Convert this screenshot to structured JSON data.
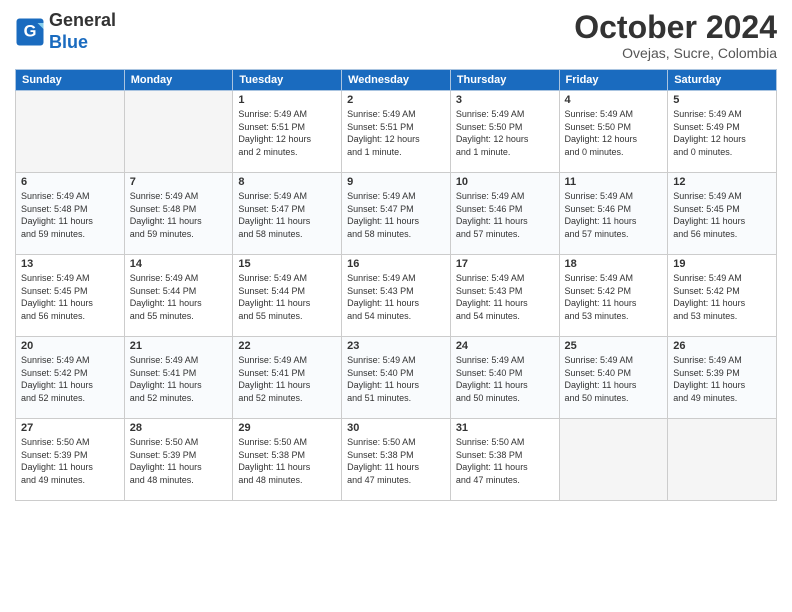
{
  "header": {
    "logo_general": "General",
    "logo_blue": "Blue",
    "month_title": "October 2024",
    "location": "Ovejas, Sucre, Colombia"
  },
  "weekdays": [
    "Sunday",
    "Monday",
    "Tuesday",
    "Wednesday",
    "Thursday",
    "Friday",
    "Saturday"
  ],
  "weeks": [
    [
      {
        "day": "",
        "info": ""
      },
      {
        "day": "",
        "info": ""
      },
      {
        "day": "1",
        "info": "Sunrise: 5:49 AM\nSunset: 5:51 PM\nDaylight: 12 hours\nand 2 minutes."
      },
      {
        "day": "2",
        "info": "Sunrise: 5:49 AM\nSunset: 5:51 PM\nDaylight: 12 hours\nand 1 minute."
      },
      {
        "day": "3",
        "info": "Sunrise: 5:49 AM\nSunset: 5:50 PM\nDaylight: 12 hours\nand 1 minute."
      },
      {
        "day": "4",
        "info": "Sunrise: 5:49 AM\nSunset: 5:50 PM\nDaylight: 12 hours\nand 0 minutes."
      },
      {
        "day": "5",
        "info": "Sunrise: 5:49 AM\nSunset: 5:49 PM\nDaylight: 12 hours\nand 0 minutes."
      }
    ],
    [
      {
        "day": "6",
        "info": "Sunrise: 5:49 AM\nSunset: 5:48 PM\nDaylight: 11 hours\nand 59 minutes."
      },
      {
        "day": "7",
        "info": "Sunrise: 5:49 AM\nSunset: 5:48 PM\nDaylight: 11 hours\nand 59 minutes."
      },
      {
        "day": "8",
        "info": "Sunrise: 5:49 AM\nSunset: 5:47 PM\nDaylight: 11 hours\nand 58 minutes."
      },
      {
        "day": "9",
        "info": "Sunrise: 5:49 AM\nSunset: 5:47 PM\nDaylight: 11 hours\nand 58 minutes."
      },
      {
        "day": "10",
        "info": "Sunrise: 5:49 AM\nSunset: 5:46 PM\nDaylight: 11 hours\nand 57 minutes."
      },
      {
        "day": "11",
        "info": "Sunrise: 5:49 AM\nSunset: 5:46 PM\nDaylight: 11 hours\nand 57 minutes."
      },
      {
        "day": "12",
        "info": "Sunrise: 5:49 AM\nSunset: 5:45 PM\nDaylight: 11 hours\nand 56 minutes."
      }
    ],
    [
      {
        "day": "13",
        "info": "Sunrise: 5:49 AM\nSunset: 5:45 PM\nDaylight: 11 hours\nand 56 minutes."
      },
      {
        "day": "14",
        "info": "Sunrise: 5:49 AM\nSunset: 5:44 PM\nDaylight: 11 hours\nand 55 minutes."
      },
      {
        "day": "15",
        "info": "Sunrise: 5:49 AM\nSunset: 5:44 PM\nDaylight: 11 hours\nand 55 minutes."
      },
      {
        "day": "16",
        "info": "Sunrise: 5:49 AM\nSunset: 5:43 PM\nDaylight: 11 hours\nand 54 minutes."
      },
      {
        "day": "17",
        "info": "Sunrise: 5:49 AM\nSunset: 5:43 PM\nDaylight: 11 hours\nand 54 minutes."
      },
      {
        "day": "18",
        "info": "Sunrise: 5:49 AM\nSunset: 5:42 PM\nDaylight: 11 hours\nand 53 minutes."
      },
      {
        "day": "19",
        "info": "Sunrise: 5:49 AM\nSunset: 5:42 PM\nDaylight: 11 hours\nand 53 minutes."
      }
    ],
    [
      {
        "day": "20",
        "info": "Sunrise: 5:49 AM\nSunset: 5:42 PM\nDaylight: 11 hours\nand 52 minutes."
      },
      {
        "day": "21",
        "info": "Sunrise: 5:49 AM\nSunset: 5:41 PM\nDaylight: 11 hours\nand 52 minutes."
      },
      {
        "day": "22",
        "info": "Sunrise: 5:49 AM\nSunset: 5:41 PM\nDaylight: 11 hours\nand 52 minutes."
      },
      {
        "day": "23",
        "info": "Sunrise: 5:49 AM\nSunset: 5:40 PM\nDaylight: 11 hours\nand 51 minutes."
      },
      {
        "day": "24",
        "info": "Sunrise: 5:49 AM\nSunset: 5:40 PM\nDaylight: 11 hours\nand 50 minutes."
      },
      {
        "day": "25",
        "info": "Sunrise: 5:49 AM\nSunset: 5:40 PM\nDaylight: 11 hours\nand 50 minutes."
      },
      {
        "day": "26",
        "info": "Sunrise: 5:49 AM\nSunset: 5:39 PM\nDaylight: 11 hours\nand 49 minutes."
      }
    ],
    [
      {
        "day": "27",
        "info": "Sunrise: 5:50 AM\nSunset: 5:39 PM\nDaylight: 11 hours\nand 49 minutes."
      },
      {
        "day": "28",
        "info": "Sunrise: 5:50 AM\nSunset: 5:39 PM\nDaylight: 11 hours\nand 48 minutes."
      },
      {
        "day": "29",
        "info": "Sunrise: 5:50 AM\nSunset: 5:38 PM\nDaylight: 11 hours\nand 48 minutes."
      },
      {
        "day": "30",
        "info": "Sunrise: 5:50 AM\nSunset: 5:38 PM\nDaylight: 11 hours\nand 47 minutes."
      },
      {
        "day": "31",
        "info": "Sunrise: 5:50 AM\nSunset: 5:38 PM\nDaylight: 11 hours\nand 47 minutes."
      },
      {
        "day": "",
        "info": ""
      },
      {
        "day": "",
        "info": ""
      }
    ]
  ]
}
